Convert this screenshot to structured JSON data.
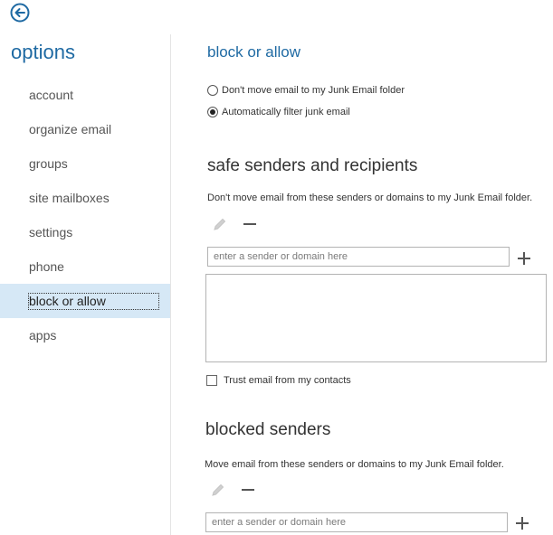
{
  "sidebar": {
    "title": "options",
    "items": [
      {
        "label": "account"
      },
      {
        "label": "organize email"
      },
      {
        "label": "groups"
      },
      {
        "label": "site mailboxes"
      },
      {
        "label": "settings"
      },
      {
        "label": "phone"
      },
      {
        "label": "block or allow",
        "selected": true
      },
      {
        "label": "apps"
      }
    ]
  },
  "main": {
    "title": "block or allow",
    "filter_options": [
      {
        "label": "Don't move email to my Junk Email folder",
        "checked": false
      },
      {
        "label": "Automatically filter junk email",
        "checked": true
      }
    ],
    "safe": {
      "title": "safe senders and recipients",
      "description": "Don't move email from these senders or domains to my Junk Email folder.",
      "input_placeholder": "enter a sender or domain here",
      "trust_contacts_label": "Trust email from my contacts",
      "trust_contacts_checked": false
    },
    "blocked": {
      "title": "blocked senders",
      "description": "Move email from these senders or domains to my Junk Email folder.",
      "input_placeholder": "enter a sender or domain here"
    }
  },
  "icons": {
    "back": "back-arrow-circle-icon",
    "edit": "pencil-icon",
    "remove": "minus-icon",
    "add": "plus-icon"
  },
  "colors": {
    "accent": "#1f6aa3",
    "selected_background": "#d6e8f6",
    "disabled_icon": "#c4c4c4"
  }
}
